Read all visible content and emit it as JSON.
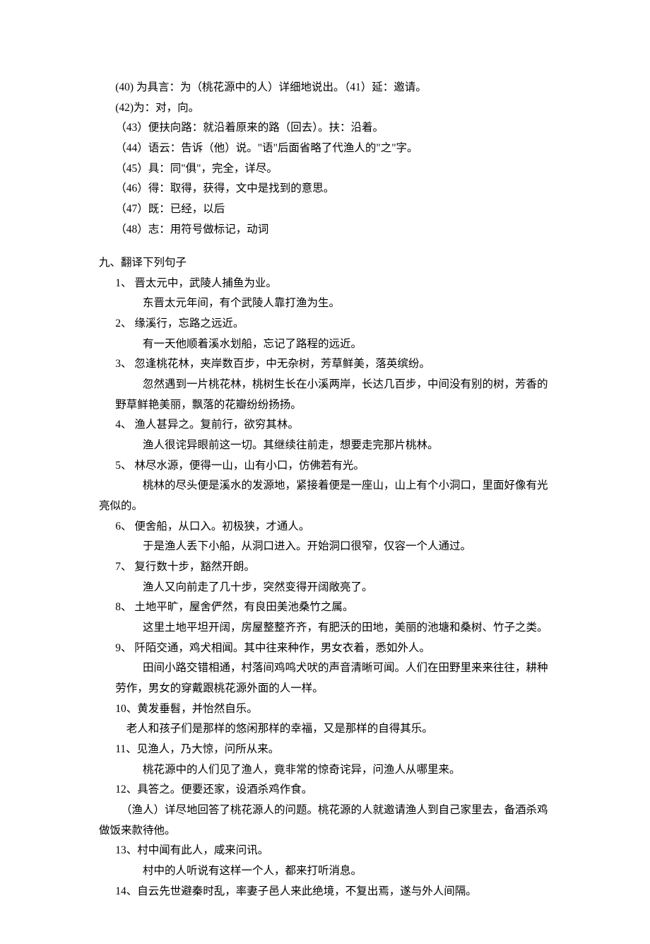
{
  "dict": {
    "n40": "(40) 为具言：为（桃花源中的人）详细地说出。（41）延：邀请。",
    "n42": "(42)为：对，向。",
    "n43": "（43）便扶向路：就沿着原来的路（回去）。扶：沿着。",
    "n44": "（44）语云：告诉（他）说。\"语\"后面省略了代渔人的\"之\"字。",
    "n45": "（45）具：同\"俱\"，完全，详尽。",
    "n46": "（46）得：取得，获得，文中是找到的意思。",
    "n47": "（47）既：已经，以后",
    "n48": "（48）志：用符号做标记，动词"
  },
  "section_title": "九、翻译下列句子",
  "trans": [
    {
      "num": "1、",
      "src": " 晋太元中，武陵人捕鱼为业。",
      "tgt": "东晋太元年间，有个武陵人靠打渔为生。"
    },
    {
      "num": "2、",
      "src": " 缘溪行，忘路之远近。",
      "tgt": "有一天他顺着溪水划船，忘记了路程的远近。"
    },
    {
      "num": "3、",
      "src": " 忽逢桃花林，夹岸数百步，中无杂树，芳草鲜美，落英缤纷。",
      "tgt": "忽然遇到一片桃花林，桃树生长在小溪两岸，长达几百步，中间没有别的树，芳香的",
      "cont": "野草鲜艳美丽，飘落的花瓣纷纷扬扬。"
    },
    {
      "num": "4、",
      "src": " 渔人甚异之。复前行，欲穷其林。",
      "tgt": "渔人很诧异眼前这一切。其继续往前走，想要走完那片桃林。"
    },
    {
      "num": "5、",
      "src": " 林尽水源，便得一山，山有小口，仿佛若有光。",
      "tgt": "桃林的尽头便是溪水的发源地，紧接着便是一座山，山上有个小洞口，里面好像有光",
      "cont2": "亮似的。"
    },
    {
      "num": "6、",
      "src": " 便舍船，从口入。初极狭，才通人。",
      "tgt": "于是渔人丢下小船，从洞口进入。开始洞口很窄，仅容一个人通过。"
    },
    {
      "num": "7、",
      "src": " 复行数十步，豁然开朗。",
      "tgt": "渔人又向前走了几十步，突然变得开阔敞亮了。"
    },
    {
      "num": "8、",
      "src": " 土地平旷，屋舍俨然，有良田美池桑竹之属。",
      "tgt": "这里土地平坦开阔，房屋整整齐齐，有肥沃的田地，美丽的池塘和桑树、竹子之类。"
    },
    {
      "num": "9、",
      "src": " 阡陌交通，鸡犬相闻。其中往来种作，男女衣着，悉如外人。",
      "tgt": "田间小路交错相通，村落间鸡鸣犬吠的声音清晰可闻。人们在田野里来来往往，耕种",
      "cont": "劳作，男女的穿戴跟桃花源外面的人一样。"
    },
    {
      "num": "10、",
      "src": "黄发垂髫，并怡然自乐。",
      "tgt2": "老人和孩子们是那样的悠闲那样的幸福，又是那样的自得其乐。"
    },
    {
      "num": "11、",
      "src": "见渔人，乃大惊，问所从来。",
      "tgt": "桃花源中的人们见了渔人，竟非常的惊奇诧异，问渔人从哪里来。"
    },
    {
      "num": "12、",
      "src": "具答之。便要还家，设酒杀鸡作食。",
      "tgt3a": "（渔人）详尽地回答了桃花源人的问题。桃花源的人就邀请渔人到自己家里去，备酒杀鸡",
      "tgt3b": "做饭来款待他。"
    },
    {
      "num": "13、",
      "src": "村中闻有此人，咸来问讯。",
      "tgt": "村中的人听说有这样一个人，都来打听消息。"
    },
    {
      "num": "14、",
      "src": "自云先世避秦时乱，率妻子邑人来此绝境，不复出焉，遂与外人间隔。"
    }
  ]
}
